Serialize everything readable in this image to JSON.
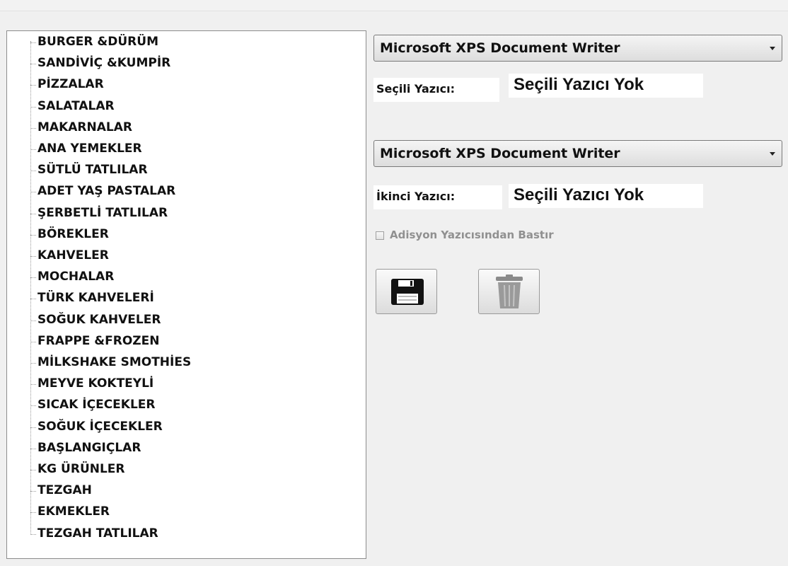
{
  "tree": {
    "items": [
      "BURGER &DÜRÜM",
      "SANDİVİÇ &KUMPİR",
      "PİZZALAR",
      "SALATALAR",
      "MAKARNALAR",
      "ANA YEMEKLER",
      "SÜTLÜ TATLILAR",
      "ADET YAŞ PASTALAR",
      "ŞERBETLİ TATLILAR",
      "BÖREKLER",
      "KAHVELER",
      "MOCHALAR",
      "TÜRK KAHVELERİ",
      "SOĞUK KAHVELER",
      "FRAPPE &FROZEN",
      "MİLKSHAKE SMOTHİES",
      "MEYVE KOKTEYLİ",
      "SICAK İÇECEKLER",
      "SOĞUK İÇECEKLER",
      "BAŞLANGIÇLAR",
      "KG ÜRÜNLER",
      "TEZGAH",
      "EKMEKLER",
      "TEZGAH TATLILAR"
    ]
  },
  "printers": {
    "primary_selected": "Microsoft XPS Document Writer",
    "primary_label": "Seçili Yazıcı:",
    "primary_value": "Seçili Yazıcı Yok",
    "secondary_selected": "Microsoft XPS Document Writer",
    "secondary_label": "İkinci Yazıcı:",
    "secondary_value": "Seçili Yazıcı Yok"
  },
  "options": {
    "adisyon_checkbox_label": "Adisyon Yazıcısından Bastır",
    "adisyon_checked": false
  },
  "buttons": {
    "save_icon": "floppy-disk-icon",
    "delete_icon": "trash-can-icon"
  }
}
